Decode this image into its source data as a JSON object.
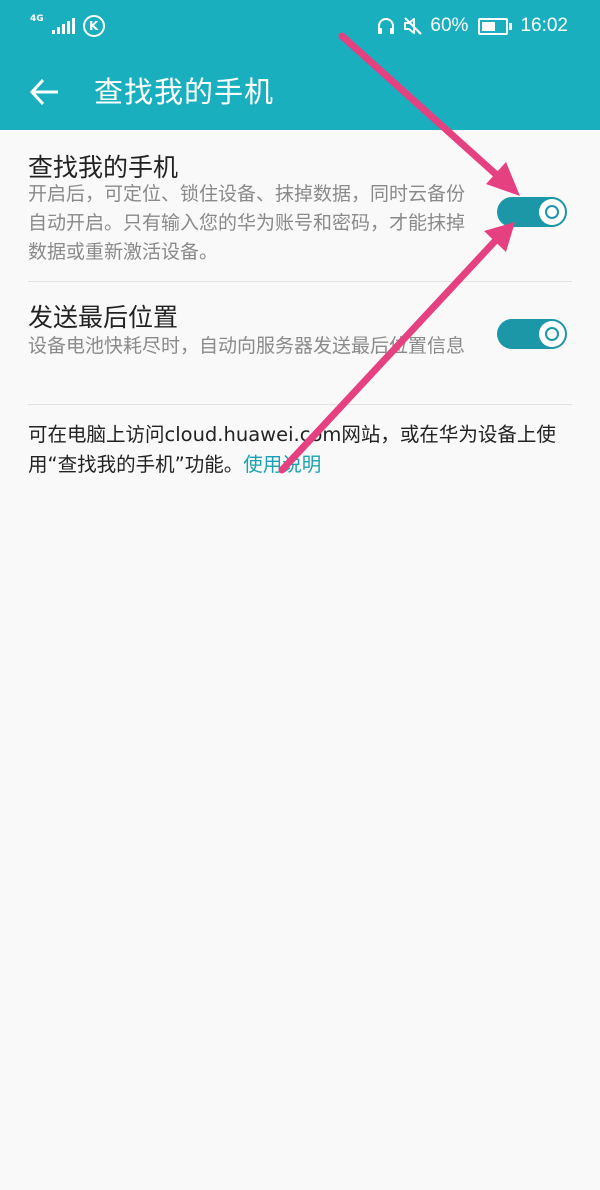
{
  "status_bar": {
    "network": "4G",
    "battery_percent": "60%",
    "battery_level": 0.6,
    "time": "16:02",
    "icons": [
      "signal-icon",
      "k-icon",
      "headphones-icon",
      "mute-icon",
      "battery-icon"
    ]
  },
  "header": {
    "back_icon": "arrow-left-icon",
    "title": "查找我的手机"
  },
  "settings": [
    {
      "title": "查找我的手机",
      "description": "开启后，可定位、锁住设备、抹掉数据，同时云备份自动开启。只有输入您的华为账号和密码，才能抹掉数据或重新激活设备。",
      "enabled": true
    },
    {
      "title": "发送最后位置",
      "description": "设备电池快耗尽时，自动向服务器发送最后位置信息",
      "enabled": true
    }
  ],
  "footer": {
    "text": "可在电脑上访问cloud.huawei.com网站，或在华为设备上使用“查找我的手机”功能。",
    "link": "使用说明"
  },
  "colors": {
    "accent": "#1aafbe",
    "toggle_on": "#1b97a7",
    "annotation_arrow": "#e5407f",
    "background": "#f9f9fa"
  }
}
